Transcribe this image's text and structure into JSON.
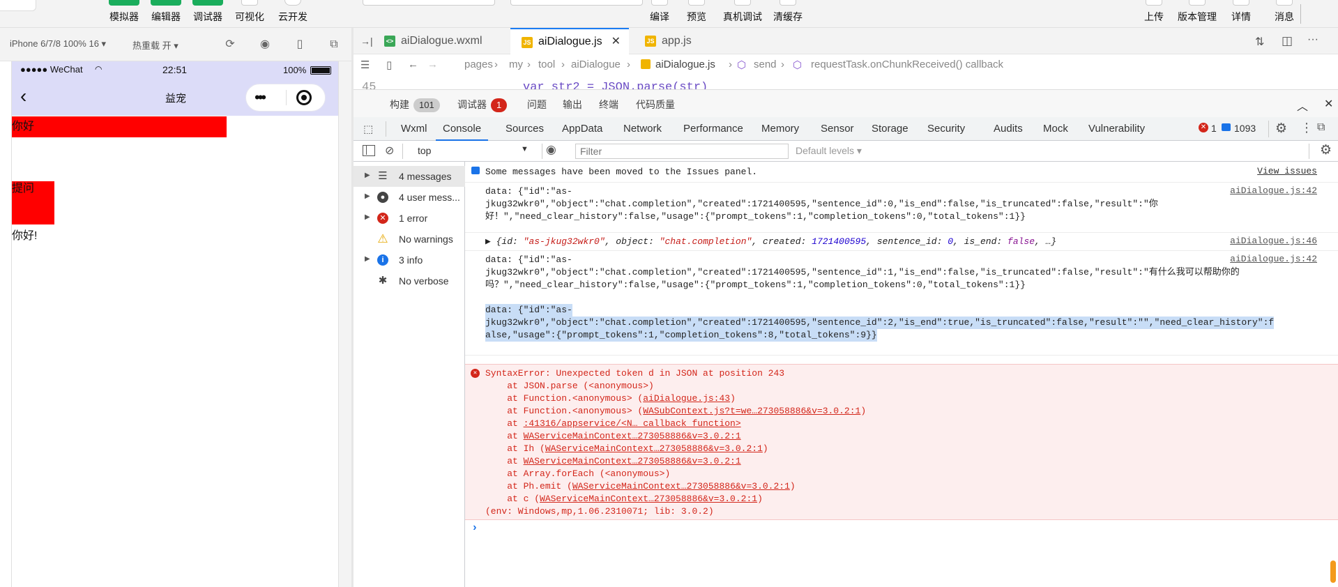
{
  "toolbar": {
    "buttons": [
      "模拟器",
      "编辑器",
      "调试器",
      "可视化",
      "云开发"
    ],
    "center_buttons": [
      "编译",
      "预览",
      "真机调试",
      "清缓存"
    ],
    "right_buttons": [
      "上传",
      "版本管理",
      "详情",
      "消息"
    ]
  },
  "simulator": {
    "device": "iPhone 6/7/8 100% 16 ▾",
    "hot_reload": "热重载 开 ▾",
    "status_left": "●●●●● WeChat",
    "time": "22:51",
    "battery": "100%",
    "nav_title": "益宠",
    "content": {
      "hello_block": "你好",
      "ask_button": "提问",
      "reply": "你好!"
    }
  },
  "editor": {
    "tabs": [
      "aiDialogue.wxml",
      "aiDialogue.js",
      "app.js"
    ],
    "active_tab": "aiDialogue.js",
    "breadcrumb": [
      "pages",
      "my",
      "tool",
      "aiDialogue",
      "aiDialogue.js",
      "send",
      "requestTask.onChunkReceived() callback"
    ],
    "peek_line_no": "45",
    "peek_code": "var str2 = JSON.parse(str)"
  },
  "devtools": {
    "top_tabs": [
      {
        "label": "构建",
        "badge": "101"
      },
      {
        "label": "调试器",
        "badge": "1"
      },
      {
        "label": "问题"
      },
      {
        "label": "输出"
      },
      {
        "label": "终端"
      },
      {
        "label": "代码质量"
      }
    ],
    "panels": [
      "Wxml",
      "Console",
      "Sources",
      "AppData",
      "Network",
      "Performance",
      "Memory",
      "Sensor",
      "Storage",
      "Security",
      "Audits",
      "Mock",
      "Vulnerability"
    ],
    "active_panel": "Console",
    "error_count": "1",
    "message_count": "1093",
    "context": "top",
    "filter_placeholder": "Filter",
    "levels": "Default levels ▾",
    "sidebar": [
      {
        "label": "4 messages",
        "icon": "list-icon"
      },
      {
        "label": "4 user mess...",
        "icon": "user-icon"
      },
      {
        "label": "1 error",
        "icon": "error-icon"
      },
      {
        "label": "No warnings",
        "icon": "warning-icon"
      },
      {
        "label": "3 info",
        "icon": "info-icon"
      },
      {
        "label": "No verbose",
        "icon": "bug-icon"
      }
    ],
    "console": {
      "issues_notice": "Some messages have been moved to the Issues panel.",
      "view_issues": "View issues",
      "log1_l1": "data: {\"id\":\"as-",
      "log1_l2": "jkug32wkr0\",\"object\":\"chat.completion\",\"created\":1721400595,\"sentence_id\":0,\"is_end\":false,\"is_truncated\":false,\"result\":\"你",
      "log1_l3": "好！\",\"need_clear_history\":false,\"usage\":{\"prompt_tokens\":1,\"completion_tokens\":0,\"total_tokens\":1}}",
      "log1_src": "aiDialogue.js:42",
      "obj_prefix": "▶ {id: ",
      "obj_id": "\"as-jkug32wkr0\"",
      "obj_mid1": ", object: ",
      "obj_object": "\"chat.completion\"",
      "obj_mid2": ", created: ",
      "obj_created": "1721400595",
      "obj_mid3": ", sentence_id: ",
      "obj_sid": "0",
      "obj_mid4": ", is_end: ",
      "obj_end": "false",
      "obj_suffix": ", …}",
      "obj_src": "aiDialogue.js:46",
      "log2_l1": "data: {\"id\":\"as-",
      "log2_l2": "jkug32wkr0\",\"object\":\"chat.completion\",\"created\":1721400595,\"sentence_id\":1,\"is_end\":false,\"is_truncated\":false,\"result\":\"有什么我可以帮助你的",
      "log2_l3": "吗？\",\"need_clear_history\":false,\"usage\":{\"prompt_tokens\":1,\"completion_tokens\":0,\"total_tokens\":1}}",
      "log2_src": "aiDialogue.js:42",
      "log2_l4": "data: {\"id\":\"as-",
      "log2_l5": "jkug32wkr0\",\"object\":\"chat.completion\",\"created\":1721400595,\"sentence_id\":2,\"is_end\":true,\"is_truncated\":false,\"result\":\"\",\"need_clear_history\":f",
      "log2_l6": "alse,\"usage\":{\"prompt_tokens\":1,\"completion_tokens\":8,\"total_tokens\":9}}",
      "err_title": "SyntaxError: Unexpected token d in JSON at position 243",
      "err_stack": [
        {
          "pre": "    at JSON.parse (<anonymous>)",
          "link": "",
          "post": ""
        },
        {
          "pre": "    at Function.<anonymous> (",
          "link": "aiDialogue.js:43",
          "post": ")"
        },
        {
          "pre": "    at Function.<anonymous> (",
          "link": "WASubContext.js?t=we…273058886&v=3.0.2:1",
          "post": ")"
        },
        {
          "pre": "    at ",
          "link": ":41316/appservice/<N… callback function>",
          "post": ""
        },
        {
          "pre": "    at ",
          "link": "WAServiceMainContext…273058886&v=3.0.2:1",
          "post": ""
        },
        {
          "pre": "    at Ih (",
          "link": "WAServiceMainContext…273058886&v=3.0.2:1",
          "post": ")"
        },
        {
          "pre": "    at ",
          "link": "WAServiceMainContext…273058886&v=3.0.2:1",
          "post": ""
        },
        {
          "pre": "    at Array.forEach (<anonymous>)",
          "link": "",
          "post": ""
        },
        {
          "pre": "    at Ph.emit (",
          "link": "WAServiceMainContext…273058886&v=3.0.2:1",
          "post": ")"
        },
        {
          "pre": "    at c (",
          "link": "WAServiceMainContext…273058886&v=3.0.2:1",
          "post": ")"
        }
      ],
      "err_env": "(env: Windows,mp,1.06.2310071; lib: 3.0.2)",
      "prompt": "›"
    }
  },
  "colors": {
    "accent": "#1a73e8",
    "toolbar_green": "#1aad5c",
    "error_red": "#d3261a",
    "hello_red": "#ff0000",
    "nav_lavender": "#dcdcf8"
  }
}
